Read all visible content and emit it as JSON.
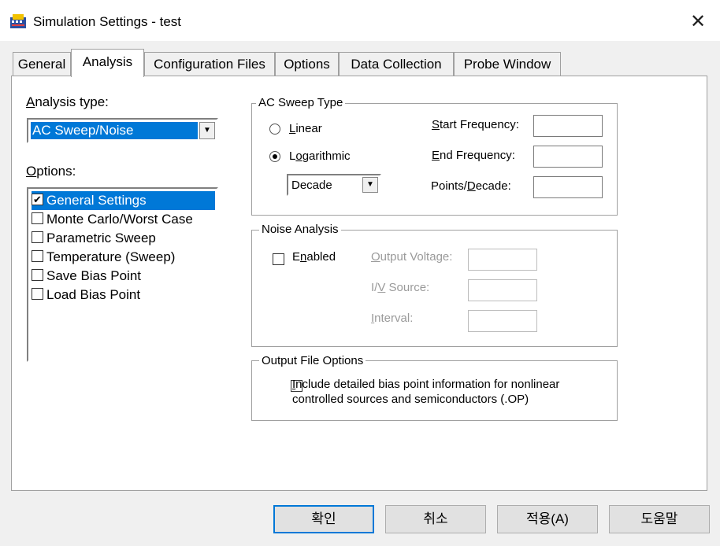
{
  "window": {
    "title": "Simulation Settings - test",
    "close_glyph": "✕"
  },
  "tabs": [
    {
      "label": "General"
    },
    {
      "label": "Analysis"
    },
    {
      "label": "Configuration Files"
    },
    {
      "label": "Options"
    },
    {
      "label": "Data Collection"
    },
    {
      "label": "Probe Window"
    }
  ],
  "analysis": {
    "type_label_u": "A",
    "type_label_rest": "nalysis type:",
    "type_value": "AC Sweep/Noise",
    "options_label_u": "O",
    "options_label_rest": "ptions:",
    "options": [
      {
        "label": "General Settings",
        "checked": "✔"
      },
      {
        "label": "Monte Carlo/Worst Case",
        "checked": ""
      },
      {
        "label": "Parametric Sweep",
        "checked": ""
      },
      {
        "label": "Temperature (Sweep)",
        "checked": ""
      },
      {
        "label": "Save Bias Point",
        "checked": ""
      },
      {
        "label": "Load Bias Point",
        "checked": ""
      }
    ]
  },
  "ac_sweep": {
    "title": "AC Sweep Type",
    "linear_u": "L",
    "linear_rest": "inear",
    "log_u": "o",
    "log_pre": "L",
    "log_rest": "garithmic",
    "log_unit": "Decade",
    "start_u": "S",
    "start_rest": "tart Frequency:",
    "end_u": "E",
    "end_rest": "nd Frequency:",
    "points_pre": "Points/",
    "points_u": "D",
    "points_rest": "ecade:",
    "start_value": "",
    "end_value": "",
    "points_value": ""
  },
  "noise": {
    "title": "Noise Analysis",
    "enabled_pre": "E",
    "enabled_u": "n",
    "enabled_rest": "abled",
    "output_u": "O",
    "output_rest": "utput Voltage:",
    "iv_pre": "I/",
    "iv_u": "V",
    "iv_rest": " Source:",
    "interval_u": "I",
    "interval_rest": "nterval:"
  },
  "output_file": {
    "title": "Output File Options",
    "include_u": "I",
    "include_rest": "nclude detailed bias point information for nonlinear",
    "include_line2": "controlled sources and semiconductors (.OP)"
  },
  "buttons": {
    "ok": "확인",
    "cancel": "취소",
    "apply": "적용(A)",
    "help": "도움말"
  },
  "colors": {
    "accent": "#0078d7",
    "window_bg": "#f0f0f0"
  }
}
